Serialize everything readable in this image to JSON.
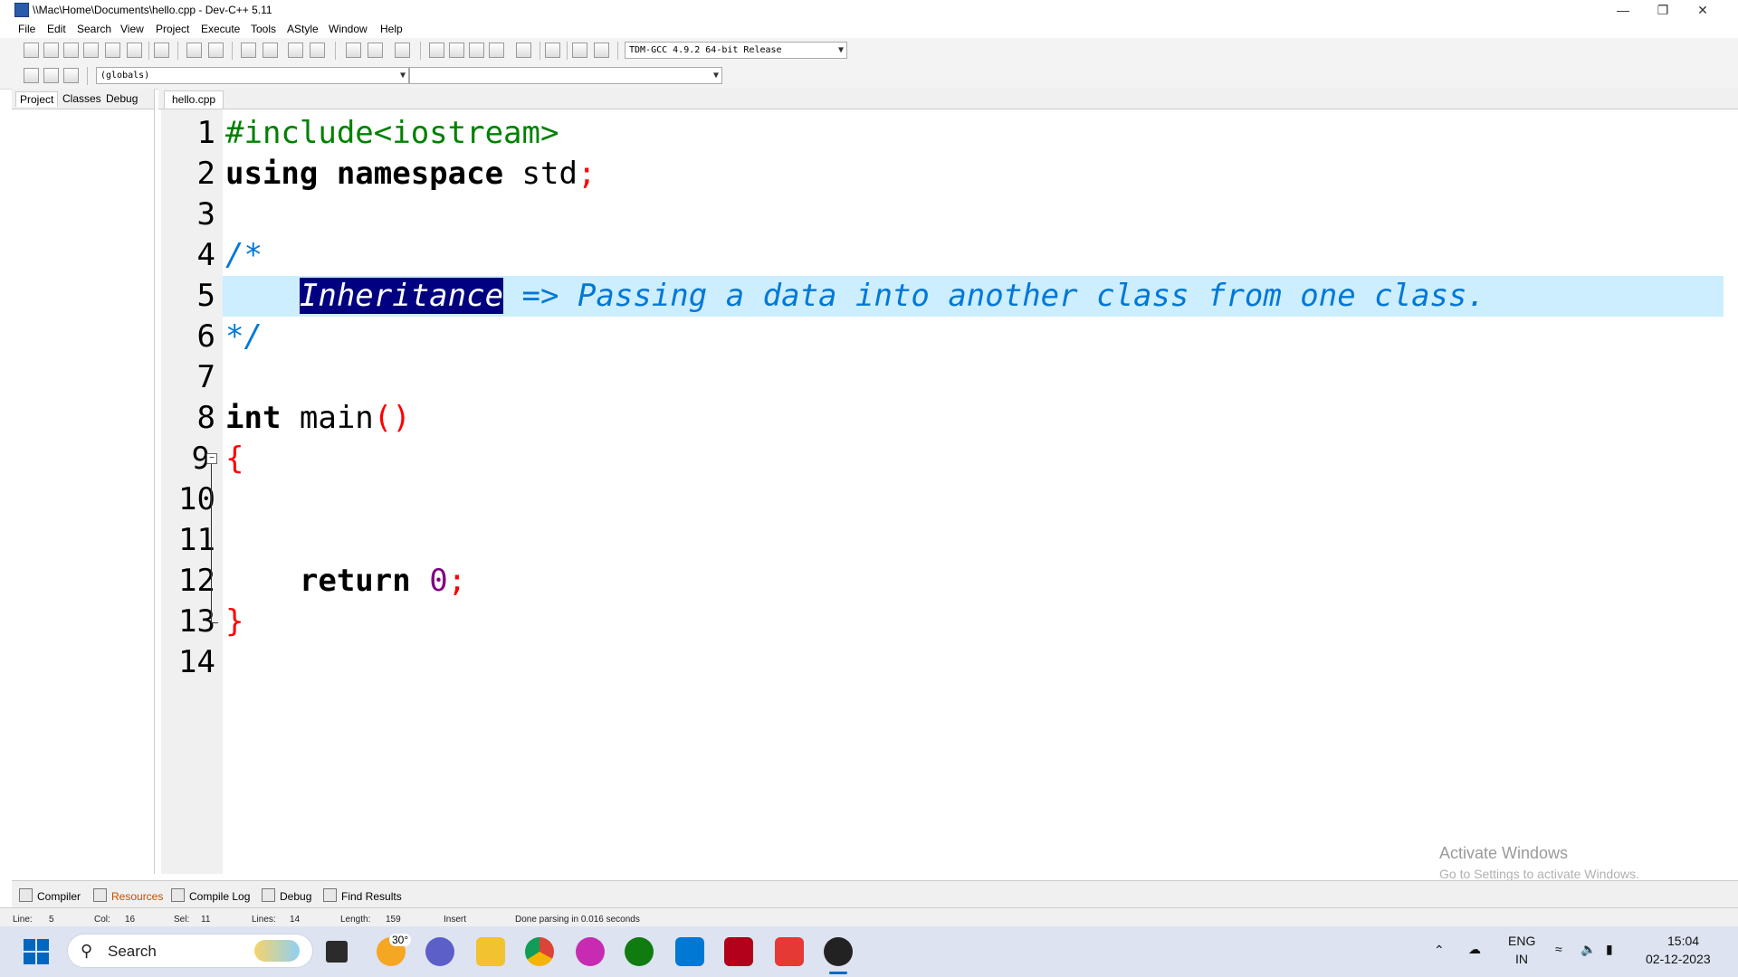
{
  "window": {
    "title": "\\\\Mac\\Home\\Documents\\hello.cpp - Dev-C++ 5.11",
    "controls": [
      "—",
      "❐",
      "✕"
    ]
  },
  "menu": [
    "File",
    "Edit",
    "Search",
    "View",
    "Project",
    "Execute",
    "Tools",
    "AStyle",
    "Window",
    "Help"
  ],
  "toolbar": {
    "compiler_select": "TDM-GCC 4.9.2 64-bit Release",
    "scope_select": "(globals)",
    "member_select": ""
  },
  "left_panel": {
    "tabs": [
      "Project",
      "Classes",
      "Debug"
    ]
  },
  "editor": {
    "tab": "hello.cpp",
    "line_numbers": [
      "1",
      "2",
      "3",
      "4",
      "5",
      "6",
      "7",
      "8",
      "9",
      "10",
      "11",
      "12",
      "13",
      "14"
    ],
    "lines": {
      "l1": "#include<iostream>",
      "l2a": "using namespace",
      "l2b": " std",
      "l2c": ";",
      "l4": "/*",
      "l5indent": "    ",
      "l5sel": "Inheritance",
      "l5rest": " => Passing a data into another class from one class.",
      "l6": "*/",
      "l8a": "int",
      "l8b": " main",
      "l8c": "()",
      "l9": "{",
      "l12indent": "    ",
      "l12a": "return",
      "l12b": " 0",
      "l12c": ";",
      "l13": "}"
    }
  },
  "bottom_tabs": [
    "Compiler",
    "Resources",
    "Compile Log",
    "Debug",
    "Find Results"
  ],
  "status": {
    "line_label": "Line:",
    "line": "5",
    "col_label": "Col:",
    "col": "16",
    "sel_label": "Sel:",
    "sel": "11",
    "lines_label": "Lines:",
    "lines": "14",
    "length_label": "Length:",
    "length": "159",
    "mode": "Insert",
    "message": "Done parsing in 0.016 seconds"
  },
  "watermark": {
    "line1": "Activate Windows",
    "line2": "Go to Settings to activate Windows."
  },
  "taskbar": {
    "search_placeholder": "Search",
    "weather_badge": "30°",
    "language": "ENG",
    "region": "IN",
    "time": "15:04",
    "date": "02-12-2023"
  }
}
